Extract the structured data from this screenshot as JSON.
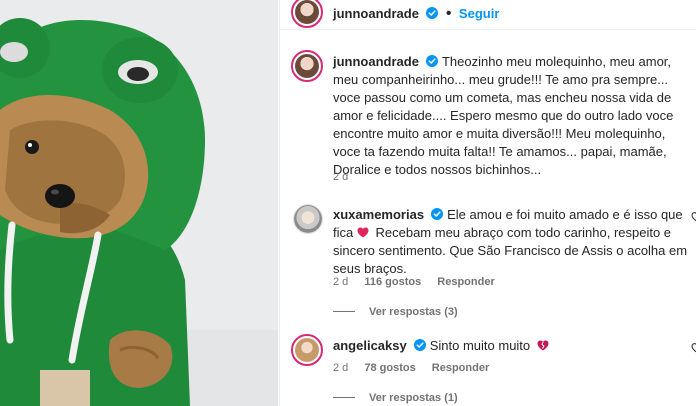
{
  "header": {
    "username": "junnoandrade",
    "follow_label": "Seguir",
    "dot": "•"
  },
  "comments": [
    {
      "username": "junnoandrade",
      "text": "Theozinho meu molequinho, meu amor, meu companheirinho... meu grude!!! Te amo pra sempre... voce passou como um cometa, mas encheu nossa vida de amor e felicidade.... Espero mesmo que do outro lado voce encontre muito amor e muita diversão!!! Meu molequinho, voce ta fazendo muita falta!! Te amamos... papai, mamãe, Doralice e todos nossos bichinhos...",
      "time": "2 d"
    },
    {
      "username": "xuxamemorias",
      "text_a": "Ele amou e foi muito amado e é isso que fica",
      "text_b": "Recebam meu abraço com todo carinho, respeito e sincero sentimento. Que São Francisco de Assis o acolha em seus braços.",
      "time": "2 d",
      "likes": "116 gostos",
      "reply": "Responder",
      "view_replies": "Ver respostas (3)"
    },
    {
      "username": "angelicaksy",
      "text": "Sinto muito muito",
      "time": "2 d",
      "likes": "78 gostos",
      "reply": "Responder",
      "view_replies": "Ver respostas (1)"
    }
  ],
  "colors": {
    "verified": "#0095f6",
    "link": "#0095f6",
    "hoodie": "#1f8a3a",
    "heart_pink": "#e0245e",
    "broken_heart": "#c2185b"
  },
  "icons": {
    "verified": "verified-badge-icon",
    "heart": "heart-icon",
    "broken_heart": "broken-heart-icon",
    "like": "like-heart-icon"
  }
}
